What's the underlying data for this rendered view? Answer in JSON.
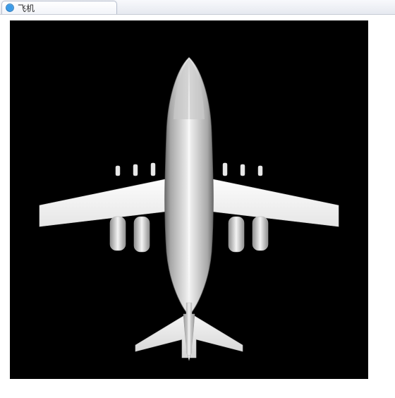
{
  "tab": {
    "title": "飞机",
    "favicon": "globe-icon"
  },
  "canvas": {
    "background": "#000000",
    "subject": "airplane-top-view",
    "body_color_light": "#f3f3f3",
    "body_color_shadow": "#8f8f8f",
    "body_color_dark": "#6c6c6c"
  }
}
